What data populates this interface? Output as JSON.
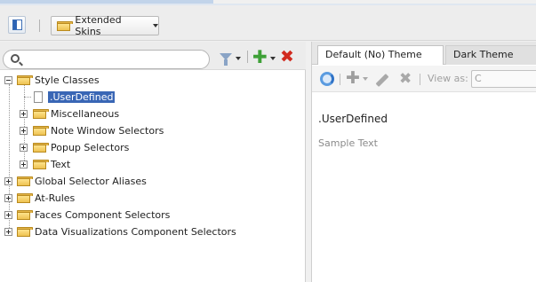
{
  "toolbar": {
    "skin_selector_label": "Extended Skins"
  },
  "left": {
    "search_value": "",
    "tree": [
      {
        "label": "Style Classes",
        "expanded": true,
        "icon": "open-folder-icon"
      },
      {
        "label": ".UserDefined",
        "selected": true,
        "icon": "document-icon"
      },
      {
        "label": "Miscellaneous",
        "icon": "folder-icon"
      },
      {
        "label": "Note Window Selectors",
        "icon": "folder-icon"
      },
      {
        "label": "Popup Selectors",
        "icon": "folder-icon"
      },
      {
        "label": "Text",
        "icon": "folder-icon"
      },
      {
        "label": "Global Selector Aliases",
        "icon": "folder-icon"
      },
      {
        "label": "At-Rules",
        "icon": "folder-icon"
      },
      {
        "label": "Faces Component Selectors",
        "icon": "folder-icon"
      },
      {
        "label": "Data Visualizations Component Selectors",
        "icon": "folder-icon"
      }
    ]
  },
  "right": {
    "tabs": [
      {
        "label": "Default (No) Theme",
        "active": true
      },
      {
        "label": "Dark Theme",
        "active": false
      }
    ],
    "view_as_label": "View as:",
    "view_as_value": "C",
    "preview_selector": ".UserDefined",
    "preview_sample": "Sample Text"
  },
  "colors": {
    "selection": "#3966b5",
    "add_green": "#3ea037",
    "delete_red": "#d12a1f",
    "folder_yellow": "#eec251"
  }
}
